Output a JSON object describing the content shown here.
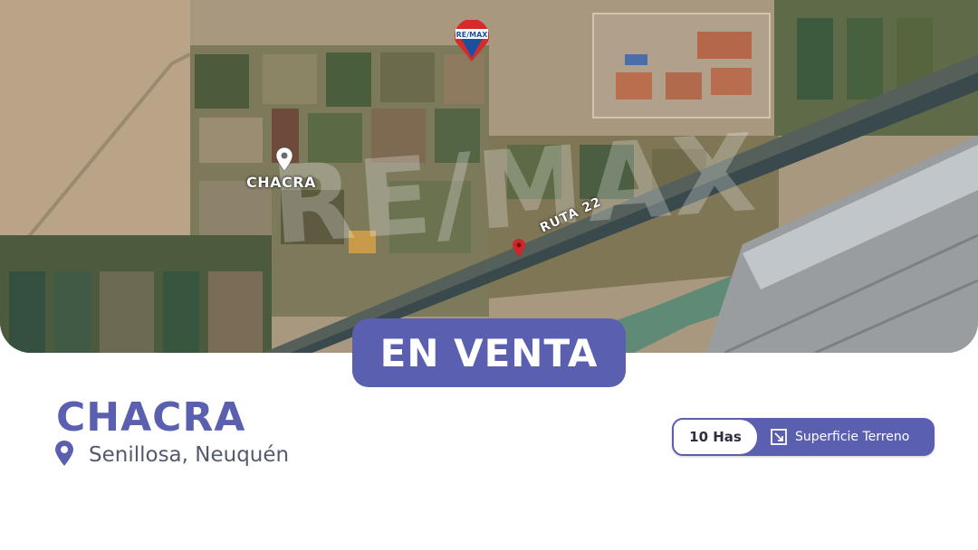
{
  "map": {
    "place_label": "CHACRA",
    "road_label": "RUTA 22",
    "brand_balloon_text": "RE/MAX",
    "watermark_text": "RE/MAX"
  },
  "badge": {
    "label": "EN VENTA"
  },
  "listing": {
    "title": "CHACRA",
    "location": "Senillosa, Neuquén"
  },
  "feature": {
    "value": "10 Has",
    "label": "Superficie Terreno"
  },
  "colors": {
    "brand": "#5b5fb0",
    "location_text": "#525a6e",
    "pin_red": "#d0262b"
  },
  "icons": [
    "map-pin-icon",
    "area-icon",
    "remax-balloon-icon"
  ]
}
